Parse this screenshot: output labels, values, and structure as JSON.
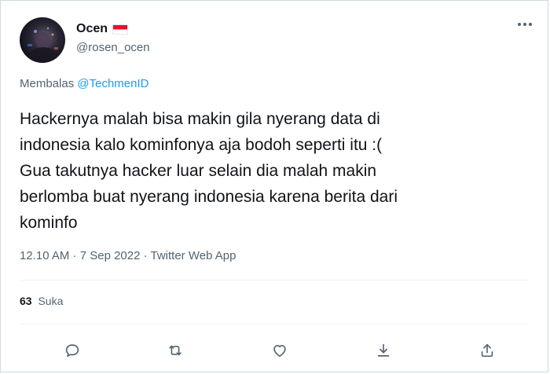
{
  "tweet": {
    "author": {
      "display_name": "Ocen",
      "flag": "indonesia-flag",
      "handle": "@rosen_ocen"
    },
    "reply_prefix": "Membalas",
    "reply_mention": "@TechmenID",
    "text": "Hackernya malah bisa makin gila nyerang data di\nindonesia kalo kominfonya aja bodoh seperti itu :(\nGua takutnya hacker luar selain dia malah makin\nberlomba buat nyerang indonesia karena berita dari\nkominfo",
    "meta": "12.10 AM · 7 Sep 2022 · Twitter Web App",
    "likes_count": "63",
    "likes_label": "Suka"
  },
  "actions": [
    {
      "icon": "reply-icon"
    },
    {
      "icon": "retweet-icon"
    },
    {
      "icon": "like-icon"
    },
    {
      "icon": "bookmark-icon"
    },
    {
      "icon": "share-icon"
    }
  ],
  "colors": {
    "accent": "#1d9bf0",
    "text_primary": "#0f1419",
    "text_secondary": "#536471",
    "border": "#cfd9de",
    "divider": "#eff3f4"
  }
}
